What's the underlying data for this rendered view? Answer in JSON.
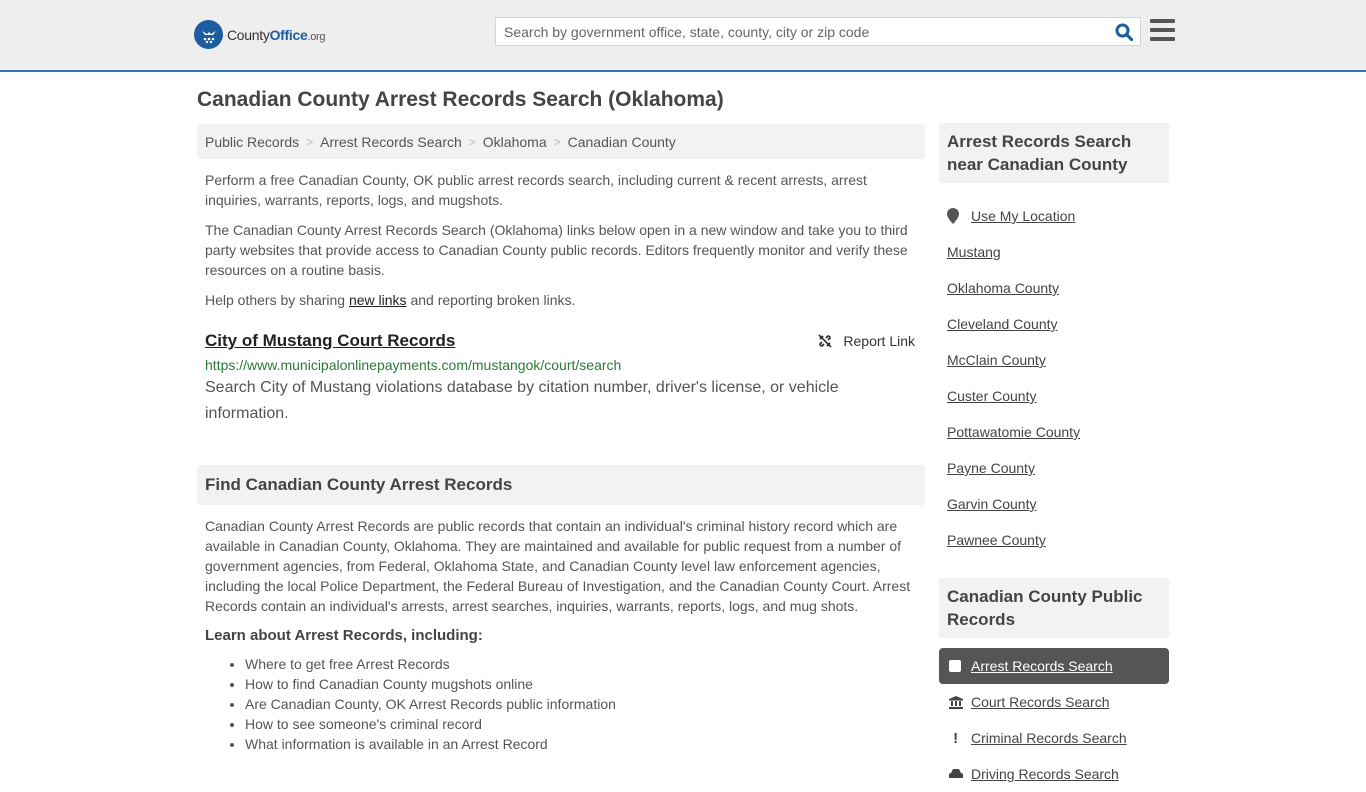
{
  "header": {
    "logo_badge": "★★★",
    "logo_county": "County",
    "logo_office": "Office",
    "logo_org": ".org",
    "search_placeholder": "Search by government office, state, county, city or zip code",
    "accent_color": "#2e75b0"
  },
  "page_title": "Canadian County Arrest Records Search (Oklahoma)",
  "breadcrumb": [
    "Public Records",
    "Arrest Records Search",
    "Oklahoma",
    "Canadian County"
  ],
  "breadcrumb_sep": ">",
  "intro": {
    "p1": "Perform a free Canadian County, OK public arrest records search, including current & recent arrests, arrest inquiries, warrants, reports, logs, and mugshots.",
    "p2": "The Canadian County Arrest Records Search (Oklahoma) links below open in a new window and take you to third party websites that provide access to Canadian County public records. Editors frequently monitor and verify these resources on a routine basis.",
    "p3_before": "Help others by sharing ",
    "p3_link": "new links",
    "p3_after": " and reporting broken links."
  },
  "record": {
    "title": "City of Mustang Court Records",
    "report_label": "Report Link",
    "url": "https://www.municipalonlinepayments.com/mustangok/court/search",
    "description": "Search City of Mustang violations database by citation number, driver's license, or vehicle information."
  },
  "find_section": {
    "heading": "Find Canadian County Arrest Records",
    "body": "Canadian County Arrest Records are public records that contain an individual's criminal history record which are available in Canadian County, Oklahoma. They are maintained and available for public request from a number of government agencies, from Federal, Oklahoma State, and Canadian County level law enforcement agencies, including the local Police Department, the Federal Bureau of Investigation, and the Canadian County Court. Arrest Records contain an individual's arrests, arrest searches, inquiries, warrants, reports, logs, and mug shots.",
    "learn_heading": "Learn about Arrest Records, including:",
    "learn_items": [
      "Where to get free Arrest Records",
      "How to find Canadian County mugshots online",
      "Are Canadian County, OK Arrest Records public information",
      "How to see someone's criminal record",
      "What information is available in an Arrest Record"
    ]
  },
  "sidebar": {
    "nearby_heading": "Arrest Records Search near Canadian County",
    "use_location": "Use My Location",
    "nearby": [
      "Mustang",
      "Oklahoma County",
      "Cleveland County",
      "McClain County",
      "Custer County",
      "Pottawatomie County",
      "Payne County",
      "Garvin County",
      "Pawnee County"
    ],
    "public_records_heading": "Canadian County Public Records",
    "public_records": [
      {
        "label": "Arrest Records Search",
        "icon": "square-icon",
        "active": true
      },
      {
        "label": "Court Records Search",
        "icon": "courthouse-icon",
        "active": false
      },
      {
        "label": "Criminal Records Search",
        "icon": "exclamation-icon",
        "active": false
      },
      {
        "label": "Driving Records Search",
        "icon": "car-icon",
        "active": false
      }
    ]
  }
}
